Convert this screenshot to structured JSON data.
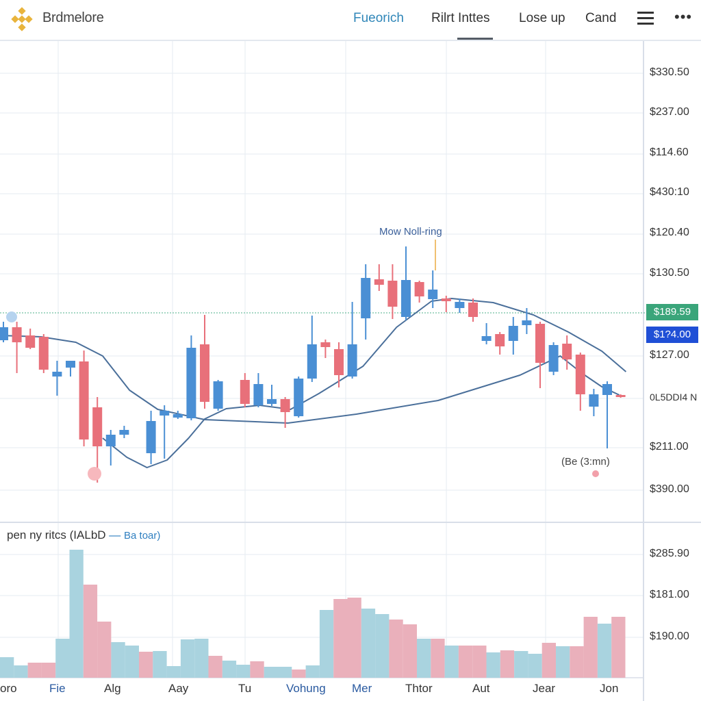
{
  "header": {
    "brand": "Brdmelore",
    "logo_icon": "diamond-logo-icon",
    "nav": [
      {
        "label": "Fueorich",
        "active": true
      },
      {
        "label": "Rilrt Inttes"
      },
      {
        "label": "Lose up"
      },
      {
        "label": "Cand"
      }
    ],
    "menu_icon": "hamburger-icon",
    "more_icon": "more-dots-icon",
    "more_glyph": "•••"
  },
  "price_axis": [
    "$330.50",
    "$237.00",
    "$114.60",
    "$430:10",
    "$120.40",
    "$130.50",
    "$127.00",
    "0L5DDI4 N",
    "$211.00",
    "$390.00"
  ],
  "price_tags": {
    "last": "$189.59",
    "last_color": "#3aa57a",
    "cursor": "$1?4.00",
    "cursor_color": "#1f4fd6"
  },
  "annotations": {
    "top": "Mow Noll-ring",
    "bottom": "(Be (3:mn)"
  },
  "volume_panel": {
    "legend_main": "pen ny ritcs (IALbD",
    "legend_dash": "—",
    "legend_sub": "Ba toar)",
    "axis": [
      "$285.90",
      "$181.00",
      "$190.00"
    ]
  },
  "x_axis": [
    "oro",
    "Fie",
    "Alg",
    "Aay",
    "Tu",
    "Vohung",
    "Mer",
    "Thtor",
    "Aut",
    "Jear",
    "Jon"
  ],
  "colors": {
    "up": "#4a8fd4",
    "down": "#e8707a",
    "vol_up": "#a9d3df",
    "vol_down": "#eab0bb",
    "ma": "#4a6f9a",
    "grid": "#e6ebf2"
  },
  "chart_data": {
    "type": "candlestick",
    "price_range": [
      0,
      340
    ],
    "grid": true,
    "last_price_line": 141.5,
    "candles": [
      [
        121.5,
        135,
        120,
        131
      ],
      [
        131,
        135,
        97.5,
        120
      ],
      [
        125,
        130,
        115,
        116
      ],
      [
        124,
        126,
        97.5,
        100
      ],
      [
        95,
        106.5,
        81,
        98.5
      ],
      [
        101.5,
        106.5,
        95,
        106.5
      ],
      [
        106,
        114,
        44,
        49
      ],
      [
        72.5,
        80,
        17.5,
        44
      ],
      [
        44,
        56,
        30,
        52.5
      ],
      [
        52.5,
        59,
        50,
        56
      ],
      null,
      [
        39,
        70,
        31,
        62.5
      ],
      [
        66.5,
        74,
        35,
        70
      ],
      [
        65,
        70,
        64,
        67.5
      ],
      [
        64.5,
        125,
        63,
        116
      ],
      [
        118.5,
        140,
        71.5,
        76.5
      ],
      [
        71.5,
        92.5,
        70,
        91.5
      ],
      null,
      [
        92.5,
        97.5,
        72.5,
        75
      ],
      [
        74,
        97.5,
        72.5,
        89.5
      ],
      [
        75,
        89,
        73.5,
        78.5
      ],
      [
        78.5,
        80,
        57.5,
        69
      ],
      [
        66,
        95,
        65,
        93.5
      ],
      [
        93.5,
        139.5,
        91,
        118.5
      ],
      [
        120,
        122,
        108.5,
        116.5
      ],
      [
        115,
        120,
        87,
        96
      ],
      [
        95,
        149.5,
        93.5,
        118.5
      ],
      [
        137.5,
        177,
        122,
        167
      ],
      [
        166,
        177,
        157.5,
        162
      ],
      [
        165,
        177,
        137,
        146
      ],
      [
        138.5,
        190,
        136,
        165.5
      ],
      [
        164,
        165,
        149,
        153.5
      ],
      [
        151.5,
        172.5,
        145,
        158.5
      ],
      [
        152,
        154,
        142,
        150
      ],
      [
        145,
        152,
        141.5,
        149.5
      ],
      [
        149,
        152,
        135,
        138.5
      ],
      [
        121,
        134,
        118.5,
        124.5
      ],
      [
        126,
        127.5,
        111,
        117
      ],
      [
        121,
        138.5,
        111,
        132
      ],
      [
        132.5,
        145,
        126,
        136
      ],
      [
        133.5,
        135,
        86.5,
        105
      ],
      [
        98.5,
        120,
        96,
        118
      ],
      [
        119,
        125,
        100,
        107.5
      ],
      [
        111,
        112.5,
        70,
        82
      ],
      [
        73,
        86,
        66,
        82
      ],
      [
        81.5,
        91.5,
        42.5,
        89.5
      ],
      [
        81.5,
        82,
        79.5,
        80.5
      ]
    ],
    "candle_fields": [
      "open",
      "high",
      "low",
      "close"
    ],
    "moving_averages": [
      {
        "points": [
          [
            -0.3,
            125
          ],
          [
            2.8,
            124
          ],
          [
            5.4,
            120
          ],
          [
            7.4,
            110
          ],
          [
            9.4,
            85
          ],
          [
            11.5,
            71
          ],
          [
            15,
            63.5
          ],
          [
            21.2,
            61
          ],
          [
            26.3,
            67.5
          ],
          [
            32.4,
            77.5
          ],
          [
            38.5,
            96
          ],
          [
            41.5,
            110
          ],
          [
            43.1,
            97.5
          ],
          [
            44.6,
            87.5
          ],
          [
            45.9,
            81.5
          ]
        ]
      },
      {
        "points": [
          [
            7.4,
            50
          ],
          [
            9.2,
            36
          ],
          [
            10.7,
            28.5
          ],
          [
            12.2,
            34
          ],
          [
            13.8,
            50
          ],
          [
            15,
            64
          ],
          [
            16.6,
            71.5
          ],
          [
            19.1,
            74
          ],
          [
            21.4,
            71
          ],
          [
            23.5,
            82.5
          ],
          [
            26.8,
            102.5
          ],
          [
            29.3,
            131
          ],
          [
            31.9,
            150
          ],
          [
            33.4,
            152
          ],
          [
            36.5,
            149
          ],
          [
            39.5,
            140
          ],
          [
            42.1,
            127.5
          ],
          [
            44.6,
            113.5
          ],
          [
            46.4,
            98.5
          ]
        ]
      }
    ],
    "volume": [
      [
        30,
        "up"
      ],
      [
        18,
        "up"
      ],
      [
        22,
        "down"
      ],
      [
        22,
        "down"
      ],
      [
        57,
        "up"
      ],
      [
        187,
        "up"
      ],
      [
        136,
        "down"
      ],
      [
        82,
        "down"
      ],
      [
        52,
        "up"
      ],
      [
        47,
        "up"
      ],
      [
        38,
        "down"
      ],
      [
        39,
        "up"
      ],
      [
        17,
        "up"
      ],
      [
        56,
        "up"
      ],
      [
        57,
        "up"
      ],
      [
        32,
        "down"
      ],
      [
        25,
        "up"
      ],
      [
        19,
        "up"
      ],
      [
        24,
        "down"
      ],
      [
        16,
        "up"
      ],
      [
        16,
        "up"
      ],
      [
        12,
        "down"
      ],
      [
        18,
        "up"
      ],
      [
        99,
        "up"
      ],
      [
        115,
        "down"
      ],
      [
        117,
        "down"
      ],
      [
        101,
        "up"
      ],
      [
        93,
        "up"
      ],
      [
        85,
        "down"
      ],
      [
        78,
        "down"
      ],
      [
        57,
        "up"
      ],
      [
        57,
        "down"
      ],
      [
        47,
        "up"
      ],
      [
        47,
        "down"
      ],
      [
        47,
        "down"
      ],
      [
        37,
        "up"
      ],
      [
        40,
        "down"
      ],
      [
        39,
        "up"
      ],
      [
        35,
        "up"
      ],
      [
        51,
        "down"
      ],
      [
        46,
        "up"
      ],
      [
        46,
        "down"
      ],
      [
        89,
        "down"
      ],
      [
        79,
        "up"
      ],
      [
        89,
        "down"
      ]
    ]
  }
}
